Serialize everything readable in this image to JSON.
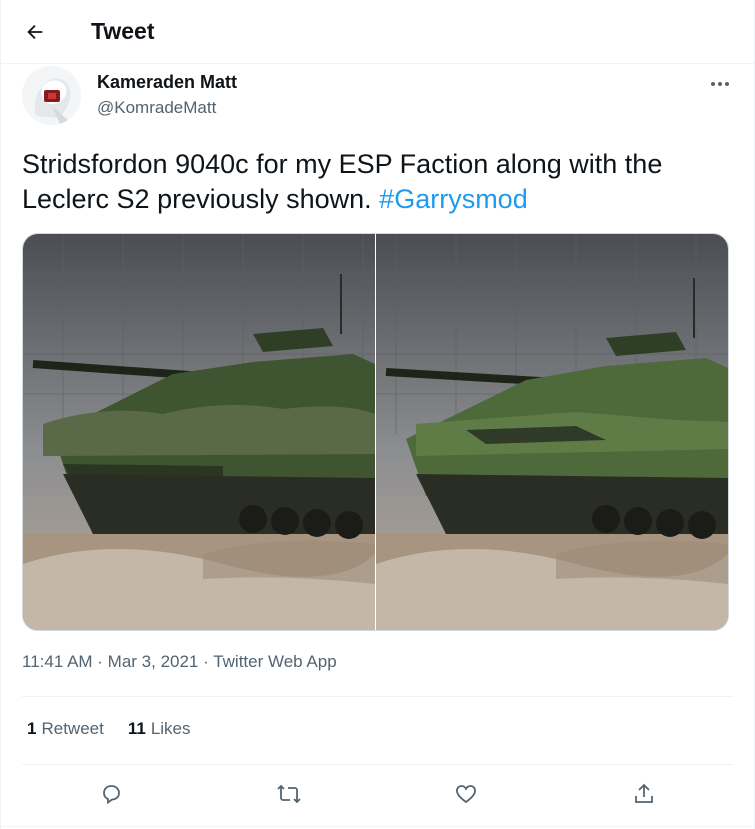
{
  "header": {
    "title": "Tweet",
    "back_icon": "arrow-left-icon"
  },
  "tweet": {
    "author_name": "Kameraden Matt",
    "author_handle": "@KomradeMatt",
    "text": "Stridsfordon 9040c for my ESP Faction along with the Leclerc S2 previously shown. ",
    "hashtag": "#Garrysmod",
    "timestamp": "11:41 AM · Mar 3, 2021 · ",
    "source": "Twitter Web App",
    "retweets_count": "1",
    "retweets_label": "Retweet",
    "likes_count": "11",
    "likes_label": "Likes"
  },
  "colors": {
    "accent": "#1d9bf0",
    "secondary_text": "#536471",
    "border": "#eff3f4"
  },
  "actions": [
    "reply-icon",
    "retweet-icon",
    "like-icon",
    "share-icon"
  ]
}
